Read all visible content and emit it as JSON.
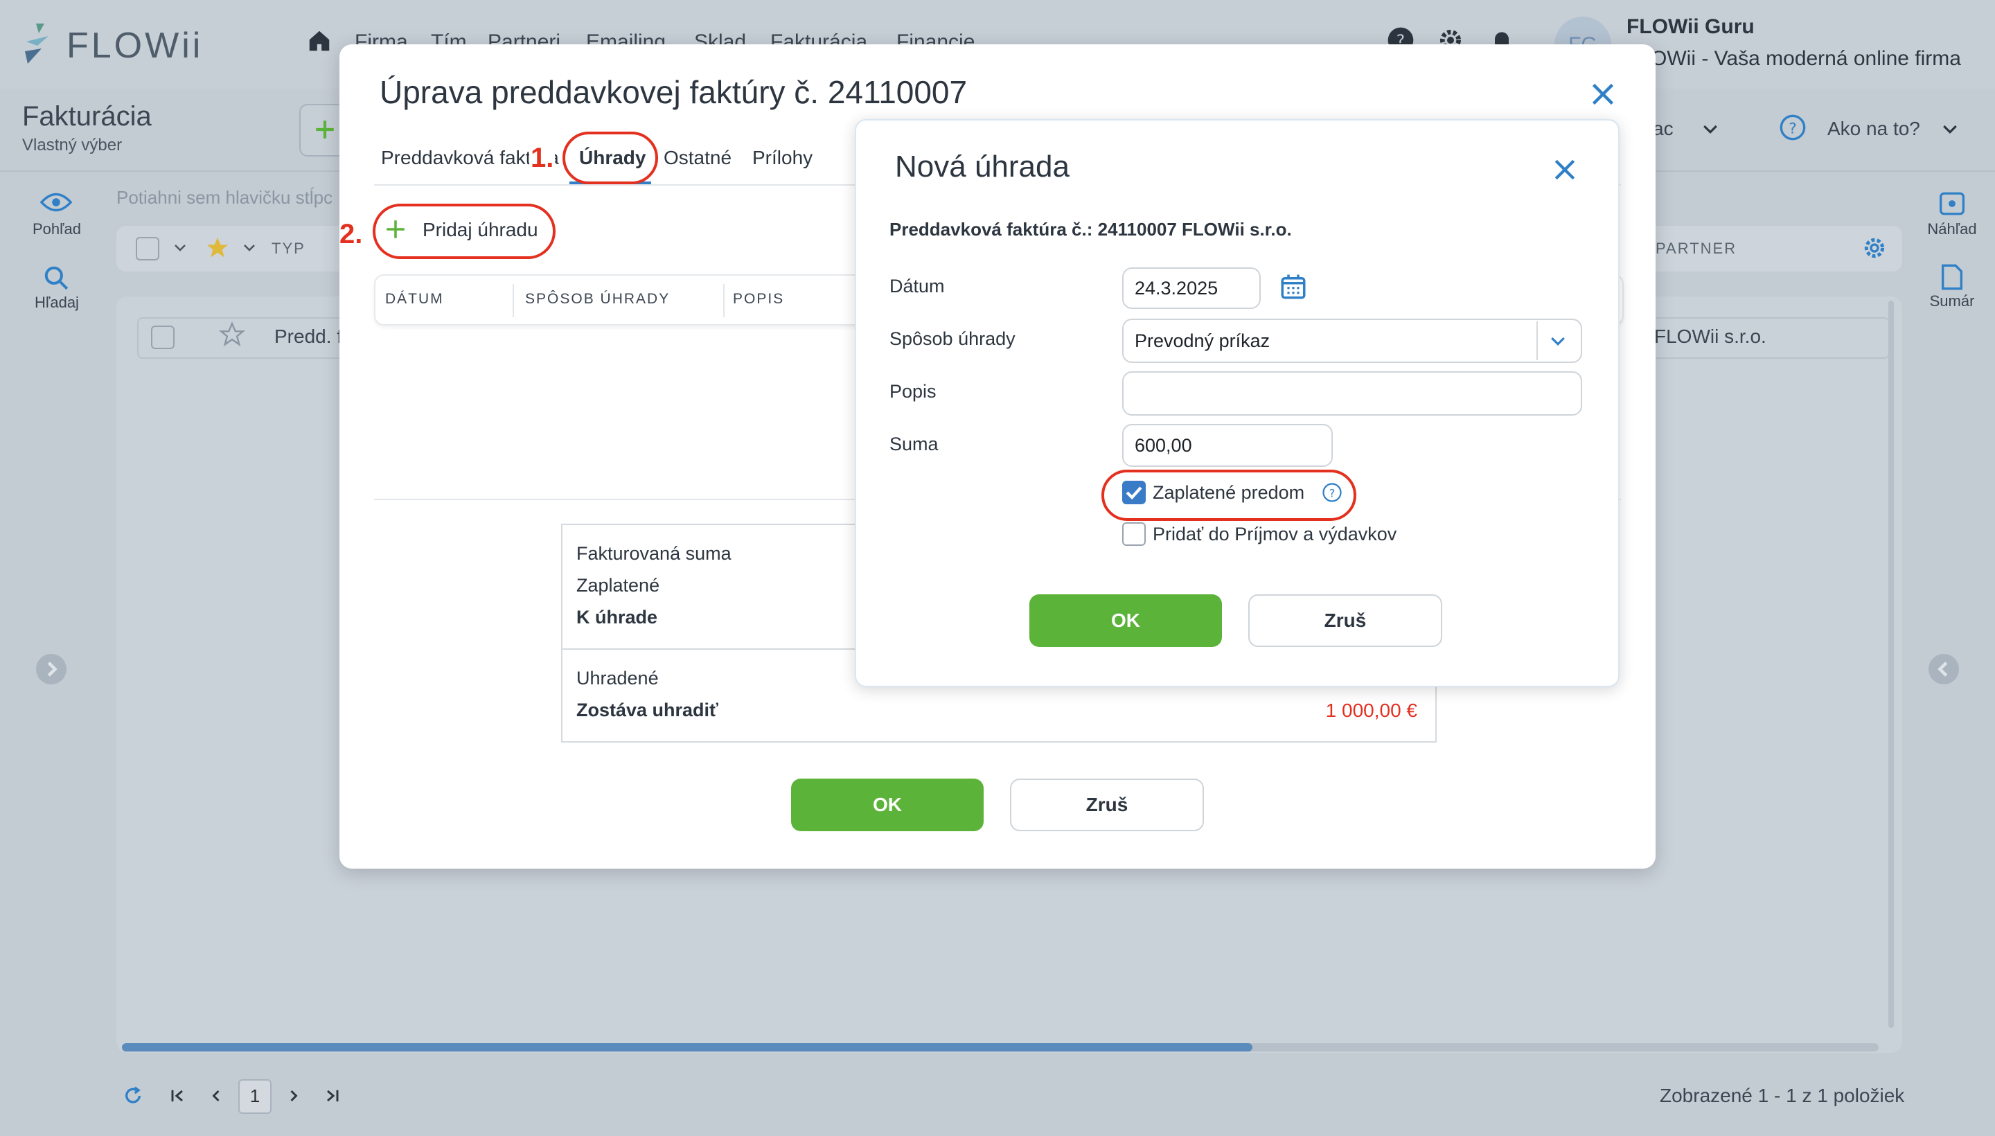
{
  "app": {
    "logo_text": "FLOWii",
    "nav": [
      "Firma",
      "Tím",
      "Partneri",
      "Emailing",
      "Sklad",
      "Fakturácia",
      "Financie"
    ],
    "user_initials": "FG",
    "user_name": "FLOWii Guru",
    "user_company": "FLOWii - Vaša moderná online firma"
  },
  "module": {
    "title": "Fakturácia",
    "subtitle": "Vlastný výber",
    "ac_label": "ac",
    "help_label": "Ako na to?",
    "drag_hint": "Potiahni sem hlavičku stĺpc",
    "col_typ": "TYP",
    "col_partner": "PARTNER",
    "row_type": "Predd. f",
    "row_partner": "FLOWii s.r.o.",
    "footer_count": "Zobrazené 1 - 1 z 1 položiek",
    "page": "1"
  },
  "sidebar": {
    "left": [
      {
        "label": "Pohľad"
      },
      {
        "label": "Hľadaj"
      }
    ],
    "right": [
      {
        "label": "Náhľad"
      },
      {
        "label": "Sumár"
      }
    ]
  },
  "modal1": {
    "title": "Úprava preddavkovej faktúry č. 24110007",
    "tabs": [
      {
        "label": "Preddavková faktúra"
      },
      {
        "label": "Úhrady"
      },
      {
        "label": "Ostatné"
      },
      {
        "label": "Prílohy"
      }
    ],
    "step1": "1.",
    "step2": "2.",
    "add_payment_label": "Pridaj úhradu",
    "columns": [
      "DÁTUM",
      "SPÔSOB ÚHRADY",
      "POPIS"
    ],
    "summary": {
      "invoiced": "Fakturovaná suma",
      "paid": "Zaplatené",
      "to_pay": "K úhrade",
      "settled": "Uhradené",
      "remaining": "Zostáva uhradiť",
      "remaining_value": "1 000,00 €"
    },
    "ok_label": "OK",
    "cancel_label": "Zruš"
  },
  "modal2": {
    "title": "Nová úhrada",
    "subtitle": "Preddavková faktúra č.: 24110007 FLOWii s.r.o.",
    "date_label": "Dátum",
    "date_value": "24.3.2025",
    "method_label": "Spôsob úhrady",
    "method_value": "Prevodný príkaz",
    "desc_label": "Popis",
    "desc_value": "",
    "sum_label": "Suma",
    "sum_value": "600,00",
    "prepaid_label": "Zaplatené predom",
    "prepaid_checked": true,
    "add_income_label": "Pridať do Príjmov a výdavkov",
    "add_income_checked": false,
    "ok_label": "OK",
    "cancel_label": "Zruš"
  },
  "colors": {
    "accent_blue": "#2f80c7",
    "ok_green": "#5cb33a",
    "annotation_red": "#e3301f",
    "remaining_red": "#e3301f"
  }
}
